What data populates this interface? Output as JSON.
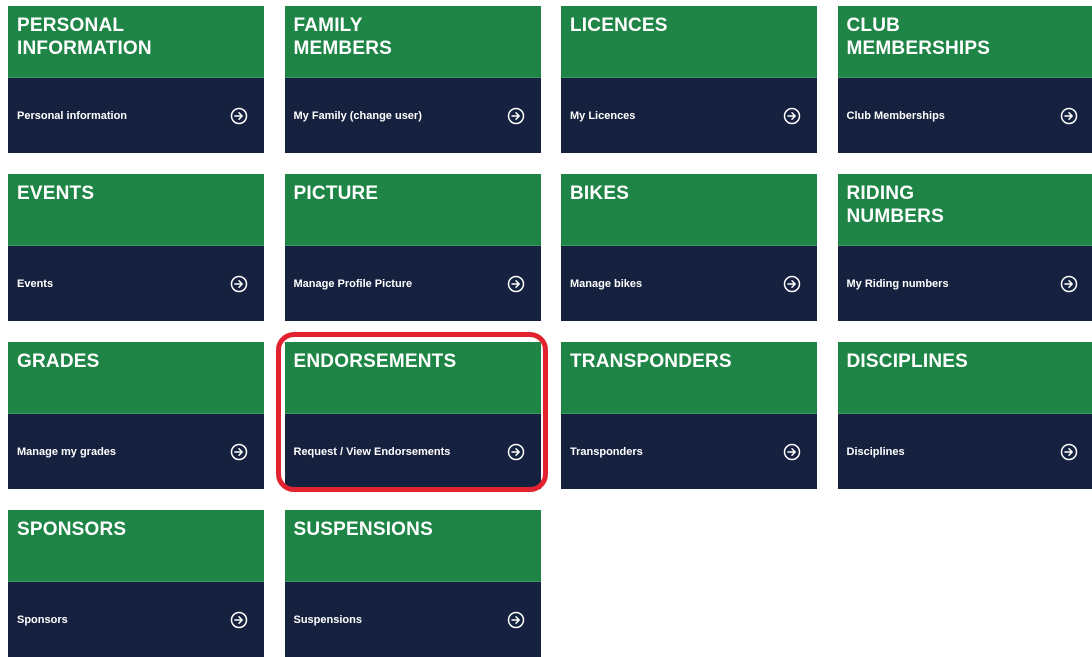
{
  "colors": {
    "tile_header": "#1e8546",
    "tile_link": "#16213f",
    "highlight": "#e0232e"
  },
  "tiles": [
    {
      "title": "PERSONAL\nINFORMATION",
      "link": "Personal information",
      "icon": "arrow-right-circle-icon"
    },
    {
      "title": "FAMILY\nMEMBERS",
      "link": "My Family (change user)",
      "icon": "arrow-right-circle-icon"
    },
    {
      "title": "LICENCES",
      "link": "My Licences",
      "icon": "arrow-right-circle-icon"
    },
    {
      "title": "CLUB\nMEMBERSHIPS",
      "link": "Club Memberships",
      "icon": "arrow-right-circle-icon"
    },
    {
      "title": "EVENTS",
      "link": "Events",
      "icon": "arrow-right-circle-icon"
    },
    {
      "title": "PICTURE",
      "link": "Manage Profile Picture",
      "icon": "arrow-right-circle-icon"
    },
    {
      "title": "BIKES",
      "link": "Manage bikes",
      "icon": "arrow-right-circle-icon"
    },
    {
      "title": "RIDING\nNUMBERS",
      "link": "My Riding numbers",
      "icon": "arrow-right-circle-icon"
    },
    {
      "title": "GRADES",
      "link": "Manage my grades",
      "icon": "arrow-right-circle-icon"
    },
    {
      "title": "ENDORSEMENTS",
      "link": "Request / View Endorsements",
      "icon": "arrow-right-circle-icon"
    },
    {
      "title": "TRANSPONDERS",
      "link": "Transponders",
      "icon": "arrow-right-circle-icon"
    },
    {
      "title": "DISCIPLINES",
      "link": "Disciplines",
      "icon": "arrow-right-circle-icon"
    },
    {
      "title": "SPONSORS",
      "link": "Sponsors",
      "icon": "arrow-right-circle-icon"
    },
    {
      "title": "SUSPENSIONS",
      "link": "Suspensions",
      "icon": "arrow-right-circle-icon"
    }
  ]
}
